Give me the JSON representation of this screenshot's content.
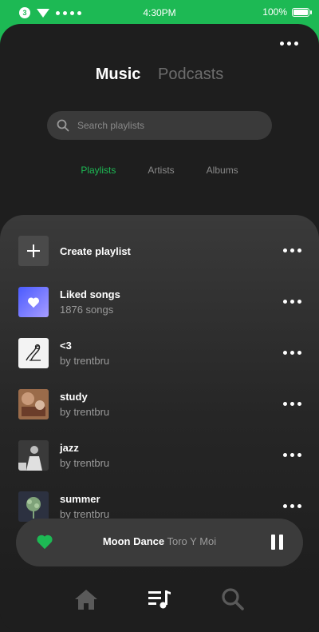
{
  "status_bar": {
    "notification_count": "3",
    "time": "4:30PM",
    "battery": "100%"
  },
  "header": {
    "tabs": [
      {
        "label": "Music",
        "active": true
      },
      {
        "label": "Podcasts",
        "active": false
      }
    ],
    "more_icon": "more-horizontal-icon"
  },
  "search": {
    "placeholder": "Search playlists",
    "icon": "search-icon"
  },
  "filters": [
    {
      "label": "Playlists",
      "active": true
    },
    {
      "label": "Artists",
      "active": false
    },
    {
      "label": "Albums",
      "active": false
    }
  ],
  "playlists": {
    "create_label": "Create playlist",
    "items": [
      {
        "title": "Liked songs",
        "subtitle": "1876 songs"
      },
      {
        "title": "<3",
        "subtitle": "by trentbru"
      },
      {
        "title": "study",
        "subtitle": "by trentbru"
      },
      {
        "title": "jazz",
        "subtitle": "by trentbru"
      },
      {
        "title": "summer",
        "subtitle": "by trentbru"
      }
    ]
  },
  "now_playing": {
    "song": "Moon Dance",
    "artist": "Toro Y Moi",
    "liked": true
  },
  "bottom_nav": [
    {
      "icon": "home-icon",
      "active": false
    },
    {
      "icon": "library-icon",
      "active": true
    },
    {
      "icon": "search-icon",
      "active": false
    }
  ],
  "colors": {
    "accent": "#1db954",
    "background": "#1e1e1e",
    "muted": "#6d6d6d"
  }
}
